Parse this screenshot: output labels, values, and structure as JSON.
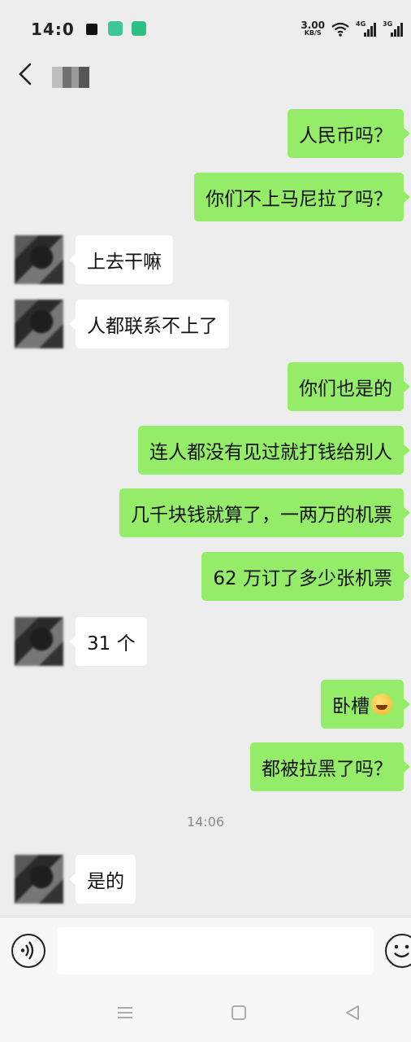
{
  "status_bar": {
    "time": "14:0",
    "speed_value": "3.00",
    "speed_unit": "KB/S",
    "signal_1_label": "4G",
    "signal_2_label": "3G"
  },
  "header": {
    "back_icon": "chevron-left-icon",
    "contact_name": ""
  },
  "messages": [
    {
      "side": "out",
      "text": "人民币吗？"
    },
    {
      "side": "out",
      "text": "你们不上马尼拉了吗？"
    },
    {
      "side": "in",
      "text": "上去干嘛"
    },
    {
      "side": "in",
      "text": "人都联系不上了"
    },
    {
      "side": "out",
      "text": "你们也是的"
    },
    {
      "side": "out",
      "text": "连人都没有见过就打钱给别人"
    },
    {
      "side": "out",
      "text": "几千块钱就算了，一两万的机票"
    },
    {
      "side": "out",
      "text": "62 万订了多少张机票"
    },
    {
      "side": "in",
      "text": "31 个"
    },
    {
      "side": "out",
      "text": "卧槽",
      "emoji": "crying-laughing-emoji"
    },
    {
      "side": "out",
      "text": "都被拉黑了吗？"
    },
    {
      "side": "in",
      "text": "是的"
    }
  ],
  "timestamp": "14:06",
  "input_bar": {
    "voice_icon": "voice-icon",
    "placeholder": "",
    "emoji_icon": "smiley-icon"
  },
  "nav_bar": {
    "menu_icon": "menu-icon",
    "home_icon": "home-square-icon",
    "back_icon": "back-triangle-icon"
  },
  "colors": {
    "background": "#ededed",
    "outgoing_bubble": "#95ec69",
    "incoming_bubble": "#ffffff"
  }
}
